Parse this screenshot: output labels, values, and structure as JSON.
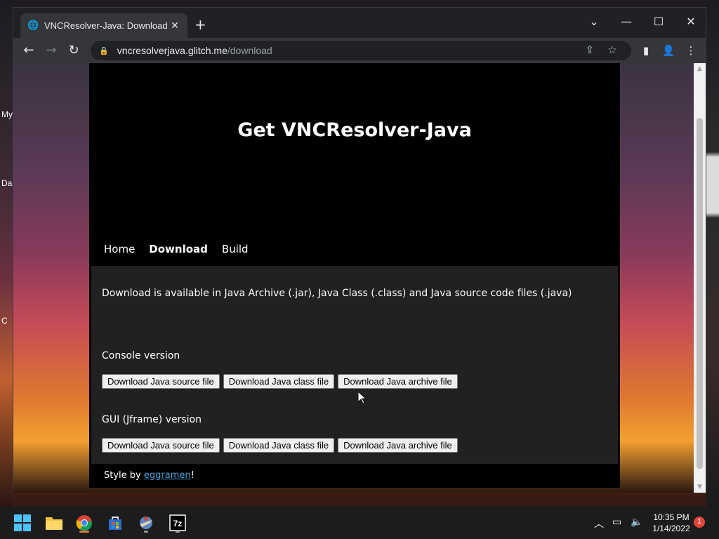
{
  "desktop": {
    "icon_labels": [
      "My",
      "Da",
      "C"
    ]
  },
  "browser": {
    "tab": {
      "title": "VNCResolver-Java: Download",
      "favicon": "globe-icon"
    },
    "url": {
      "host": "vncresolverjava.glitch.me",
      "path": "/download"
    },
    "controls": {
      "minimize": "—",
      "maximize": "☐",
      "close": "✕",
      "tab_search": "⌄"
    }
  },
  "page": {
    "title": "Get VNCResolver-Java",
    "nav": [
      {
        "label": "Home",
        "active": false
      },
      {
        "label": "Download",
        "active": true
      },
      {
        "label": "Build",
        "active": false
      }
    ],
    "intro": "Download is available in Java Archive (.jar), Java Class (.class) and Java source code files (.java)",
    "sections": [
      {
        "label": "Console version",
        "buttons": [
          "Download Java source file",
          "Download Java class file",
          "Download Java archive file"
        ]
      },
      {
        "label": "GUI (Jframe) version",
        "buttons": [
          "Download Java source file",
          "Download Java class file",
          "Download Java archive file"
        ]
      }
    ],
    "footer": {
      "prefix": "Style by ",
      "link": "eggramen",
      "suffix": "!"
    }
  },
  "taskbar": {
    "apps": [
      "windows-start-icon",
      "file-explorer-icon",
      "chrome-icon",
      "store-icon",
      "app-icon",
      "7zip-icon"
    ],
    "time": "10:35 PM",
    "date": "1/14/2022",
    "notification_count": "1",
    "sevenzip_label": "7z"
  }
}
